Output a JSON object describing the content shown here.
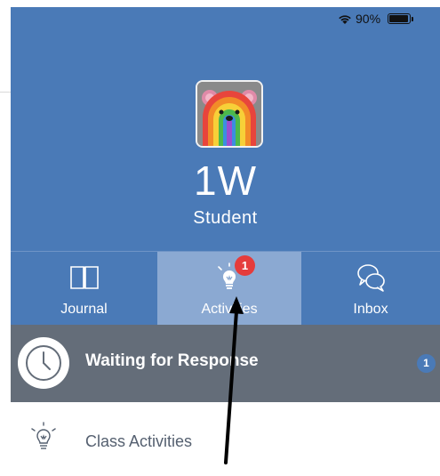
{
  "status_bar": {
    "battery_percent": "90%",
    "battery_level": 0.9,
    "icons": [
      "wifi-icon",
      "battery-icon"
    ]
  },
  "profile": {
    "avatar_icon": "rainbow-bear-avatar",
    "class_name": "1W",
    "role": "Student"
  },
  "tabs": [
    {
      "label": "Journal",
      "icon": "book-icon",
      "selected": false
    },
    {
      "label": "Activities",
      "icon": "lightbulb-icon",
      "selected": true,
      "badge": "1"
    },
    {
      "label": "Inbox",
      "icon": "chat-bubbles-icon",
      "selected": false
    }
  ],
  "waiting": {
    "title": "Waiting for Response",
    "count": "1",
    "icon": "clock-icon"
  },
  "list": [
    {
      "label": "Class Activities",
      "icon": "lightbulb-icon"
    }
  ],
  "colors": {
    "panel_blue": "#4a7ab7",
    "selected_tab": "#8ba9d2",
    "waiting_bar": "#646d79",
    "badge_red": "#e53c3c",
    "arrow": "#000000"
  }
}
